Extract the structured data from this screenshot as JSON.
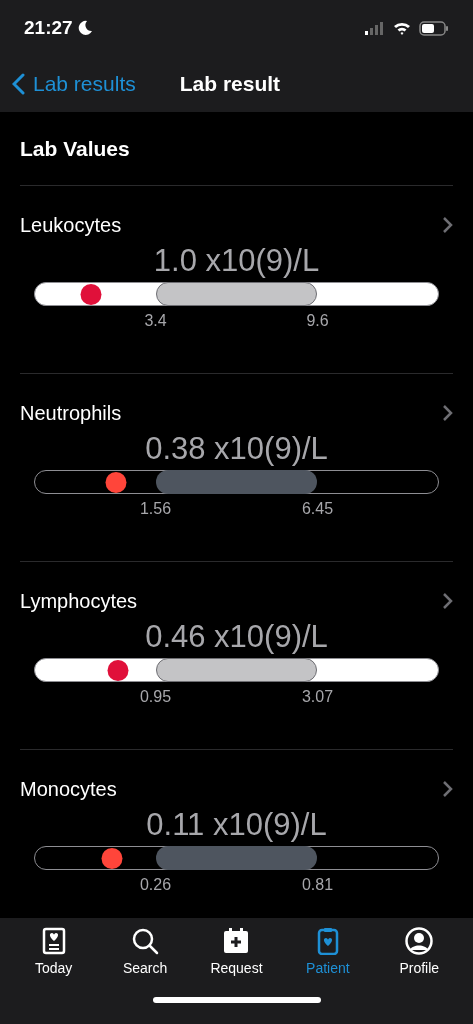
{
  "status_bar": {
    "time": "21:27"
  },
  "nav": {
    "back": "Lab results",
    "title": "Lab result"
  },
  "section_title": "Lab Values",
  "results": [
    {
      "name": "Leukocytes",
      "value": "1.0 x10(9)/L",
      "kind": "light",
      "level": 0.14,
      "low": "3.4",
      "high": "9.6"
    },
    {
      "name": "Neutrophils",
      "value": "0.38 x10(9)/L",
      "kind": "dark",
      "level": 0.2,
      "low": "1.56",
      "high": "6.45"
    },
    {
      "name": "Lymphocytes",
      "value": "0.46 x10(9)/L",
      "kind": "light",
      "level": 0.205,
      "low": "0.95",
      "high": "3.07"
    },
    {
      "name": "Monocytes",
      "value": "0.11 x10(9)/L",
      "kind": "dark",
      "level": 0.19,
      "low": "0.26",
      "high": "0.81"
    }
  ],
  "tabs": [
    {
      "label": "Today",
      "selected": false
    },
    {
      "label": "Search",
      "selected": false
    },
    {
      "label": "Request",
      "selected": false
    },
    {
      "label": "Patient",
      "selected": true
    },
    {
      "label": "Profile",
      "selected": false
    }
  ]
}
